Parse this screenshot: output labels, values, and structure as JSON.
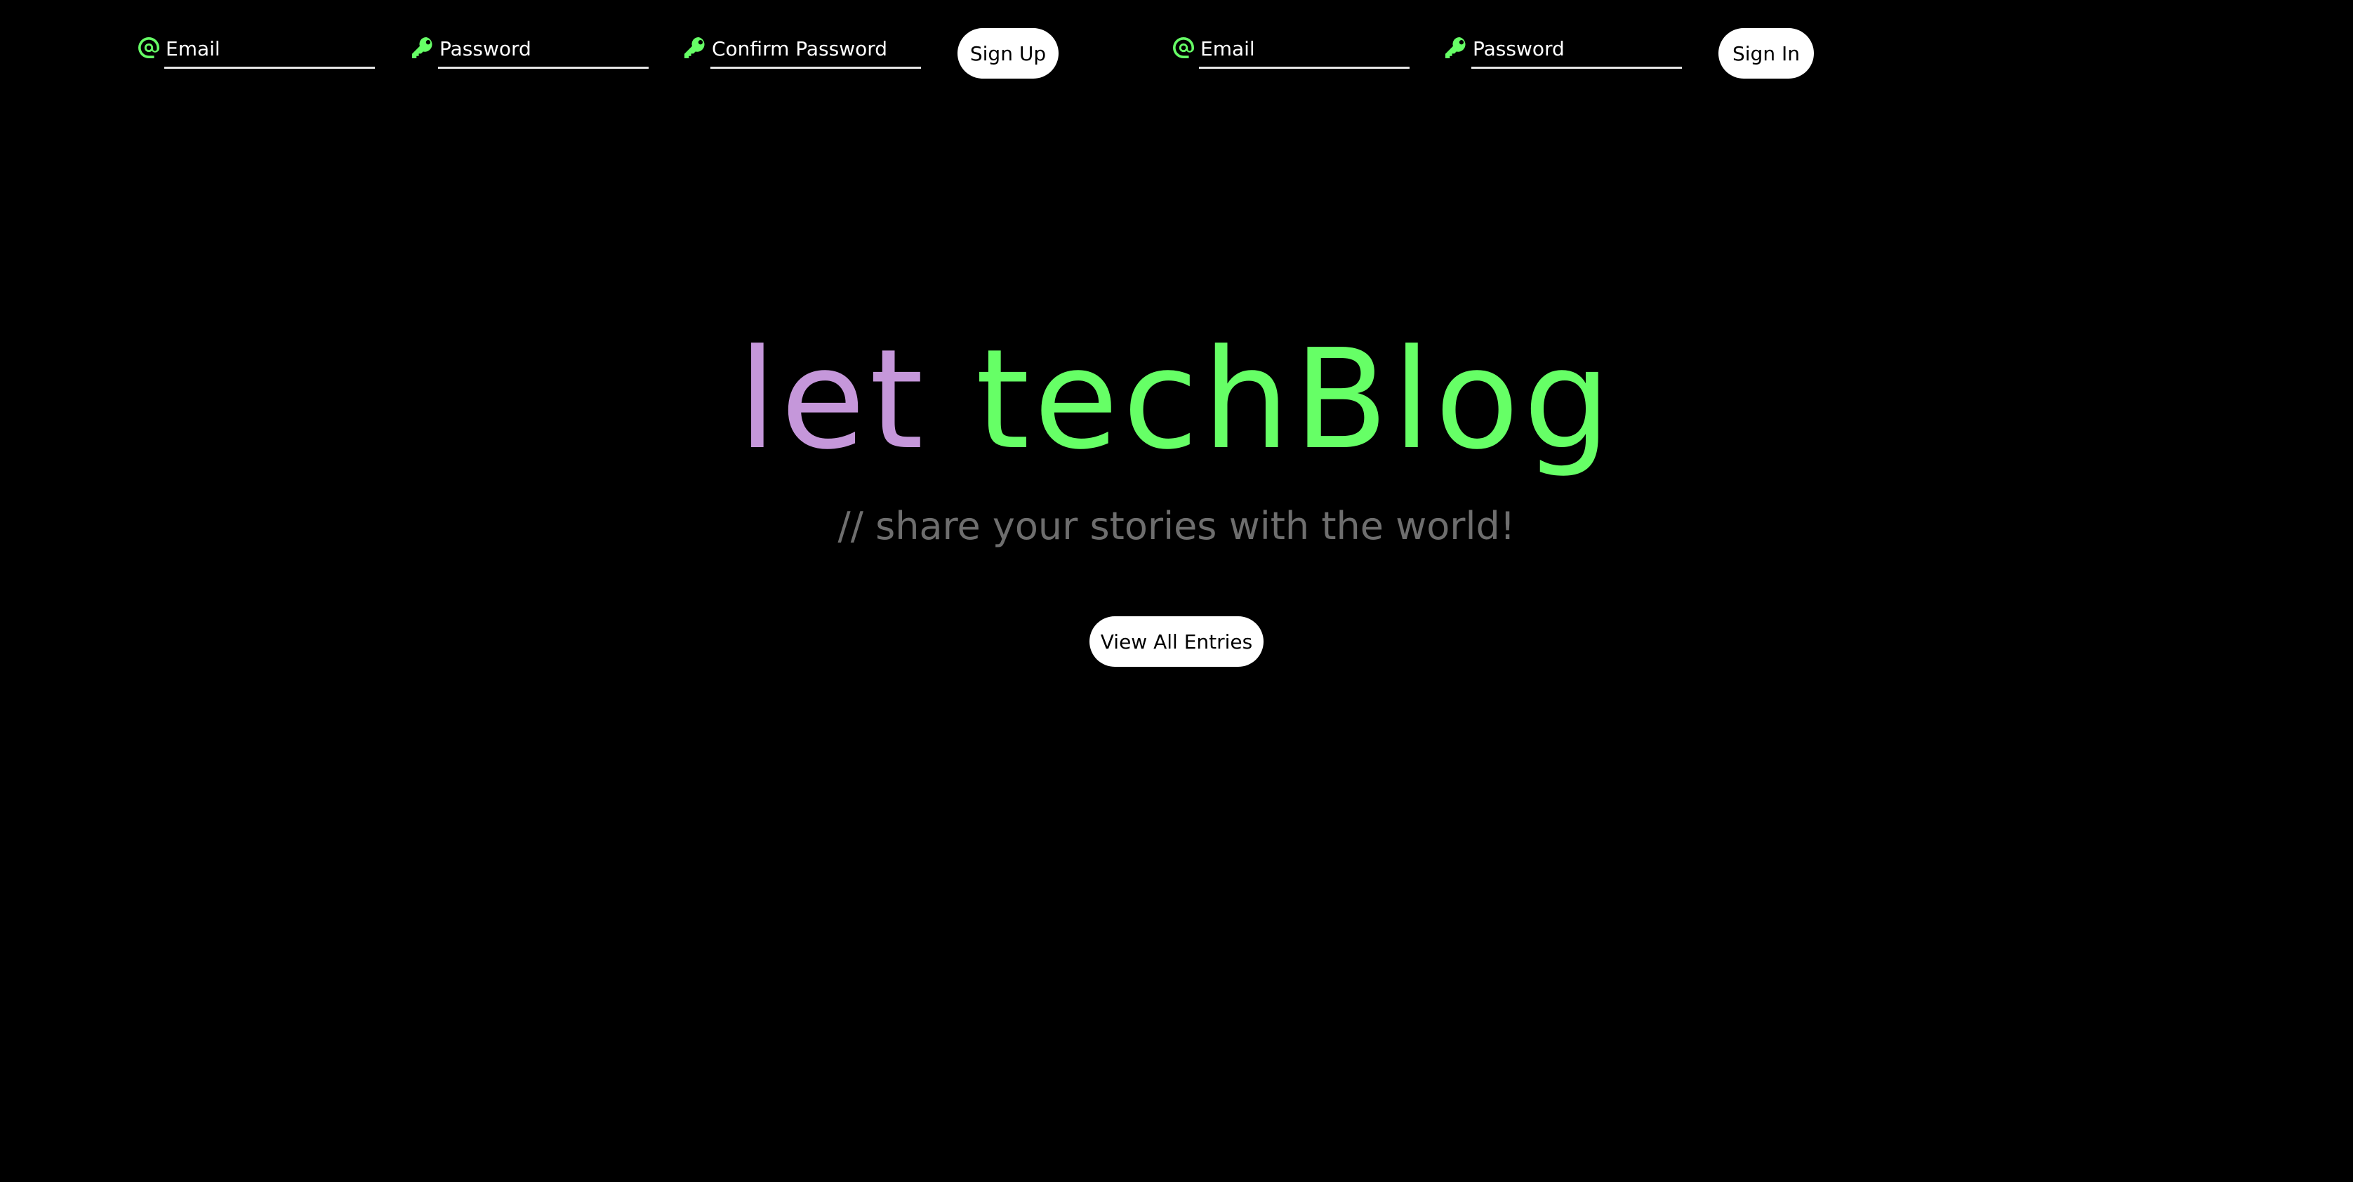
{
  "signup": {
    "email_placeholder": "Email",
    "password_placeholder": "Password",
    "confirm_password_placeholder": "Confirm Password",
    "button_label": "Sign Up"
  },
  "signin": {
    "email_placeholder": "Email",
    "password_placeholder": "Password",
    "button_label": "Sign In"
  },
  "icons": {
    "email": "at-icon",
    "password": "key-icon"
  },
  "hero": {
    "title_keyword": "let",
    "title_name": "techBlog",
    "subtitle": "// share your stories with the world!",
    "cta_label": "View All Entries"
  },
  "colors": {
    "background": "#000000",
    "accent_green": "#66ff66",
    "keyword_purple": "#c597da",
    "subtitle_gray": "#6e6e6e",
    "button_bg": "#ffffff"
  }
}
